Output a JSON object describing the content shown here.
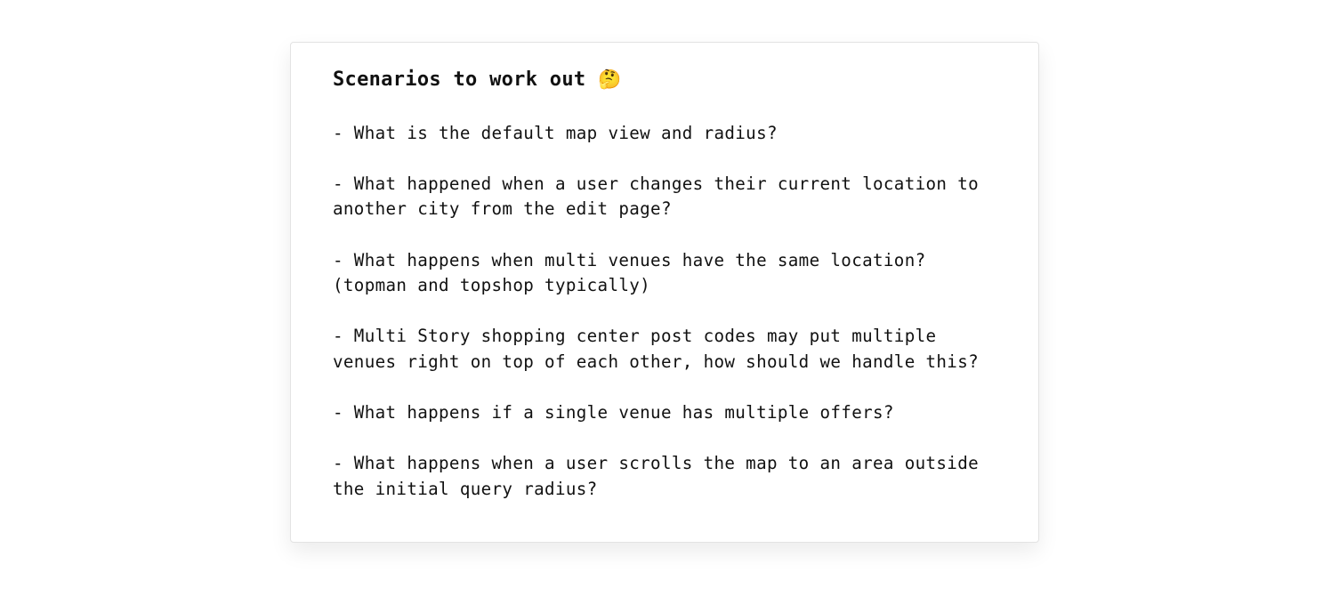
{
  "note": {
    "title": "Scenarios to work out",
    "title_emoji": "🤔",
    "items": [
      "- What is the default map view and radius?",
      "- What happened when a user changes their current location to another city from the edit page?",
      "- What happens when multi venues have the same location? (topman and topshop typically)",
      "- Multi Story shopping center post codes may put multiple venues right on top of each other, how should we handle this?",
      "- What happens if a single venue has multiple offers?",
      "- What happens when a user scrolls the map to an area outside the initial query radius?"
    ]
  }
}
